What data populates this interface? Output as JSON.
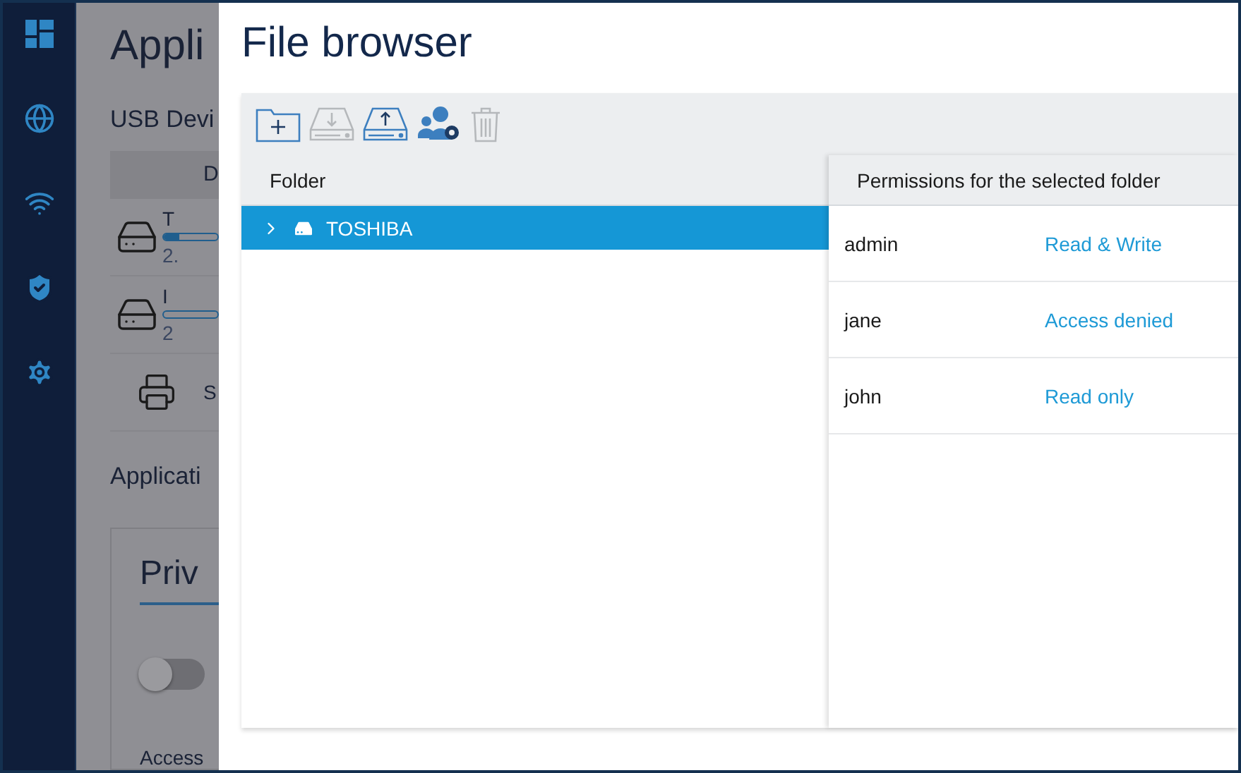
{
  "background": {
    "title": "Appli",
    "usb_heading": "USB Devi",
    "table": {
      "columns": [
        "D"
      ],
      "rows": [
        {
          "kind": "drive",
          "name": "T",
          "level": 0.3,
          "reading": "2."
        },
        {
          "kind": "drive",
          "name": "I",
          "level": 0,
          "reading": "2"
        },
        {
          "kind": "printer",
          "name": "S"
        }
      ]
    },
    "apps_heading": "Applicati",
    "card": {
      "tab": "Priv",
      "toggle_on": false,
      "label": "Access"
    }
  },
  "dialog": {
    "title": "File browser",
    "toolbar": [
      {
        "kind": "new-folder",
        "disabled": false
      },
      {
        "kind": "download",
        "disabled": true
      },
      {
        "kind": "upload",
        "disabled": false
      },
      {
        "kind": "permissions",
        "disabled": false
      },
      {
        "kind": "delete",
        "disabled": true
      }
    ],
    "folders": {
      "header": "Folder",
      "items": [
        {
          "label": "TOSHIBA",
          "selected": true,
          "expanded": false
        }
      ]
    },
    "permissions": {
      "header": "Permissions for the selected folder",
      "rows": [
        {
          "user": "admin",
          "access": "Read & Write"
        },
        {
          "user": "jane",
          "access": "Access denied"
        },
        {
          "user": "john",
          "access": "Read only"
        }
      ]
    }
  }
}
